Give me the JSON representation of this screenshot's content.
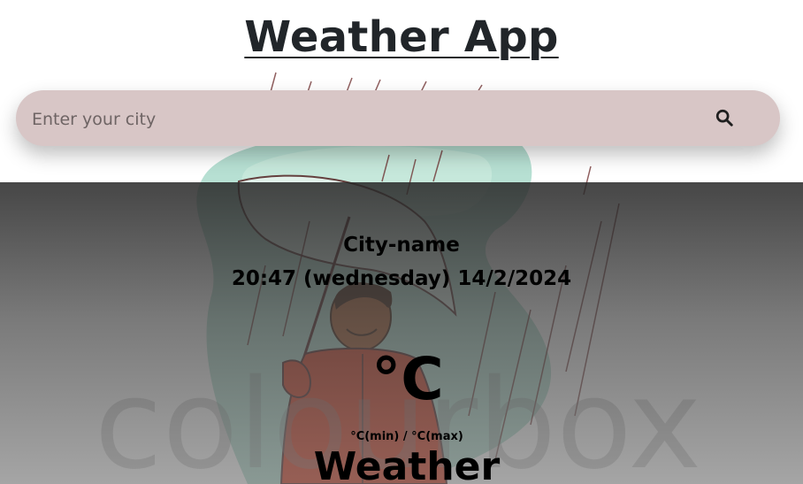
{
  "header": {
    "title": "Weather App"
  },
  "search": {
    "placeholder": "Enter your city",
    "value": "",
    "button_icon": "search-icon"
  },
  "weather": {
    "city": "City-name",
    "datetime": "20:47 (wednesday) 14/2/2024",
    "temperature": "°C",
    "min_max": "°C(min) / °C(max)",
    "description": "Weather"
  },
  "background": {
    "watermark_text": "colourbox",
    "illustration": "man-with-umbrella-in-rain"
  },
  "colors": {
    "search_bar": "#d8c6c6",
    "title": "#212529",
    "overlay_top": "#282828",
    "overlay_bottom": "#6e6e6e"
  }
}
